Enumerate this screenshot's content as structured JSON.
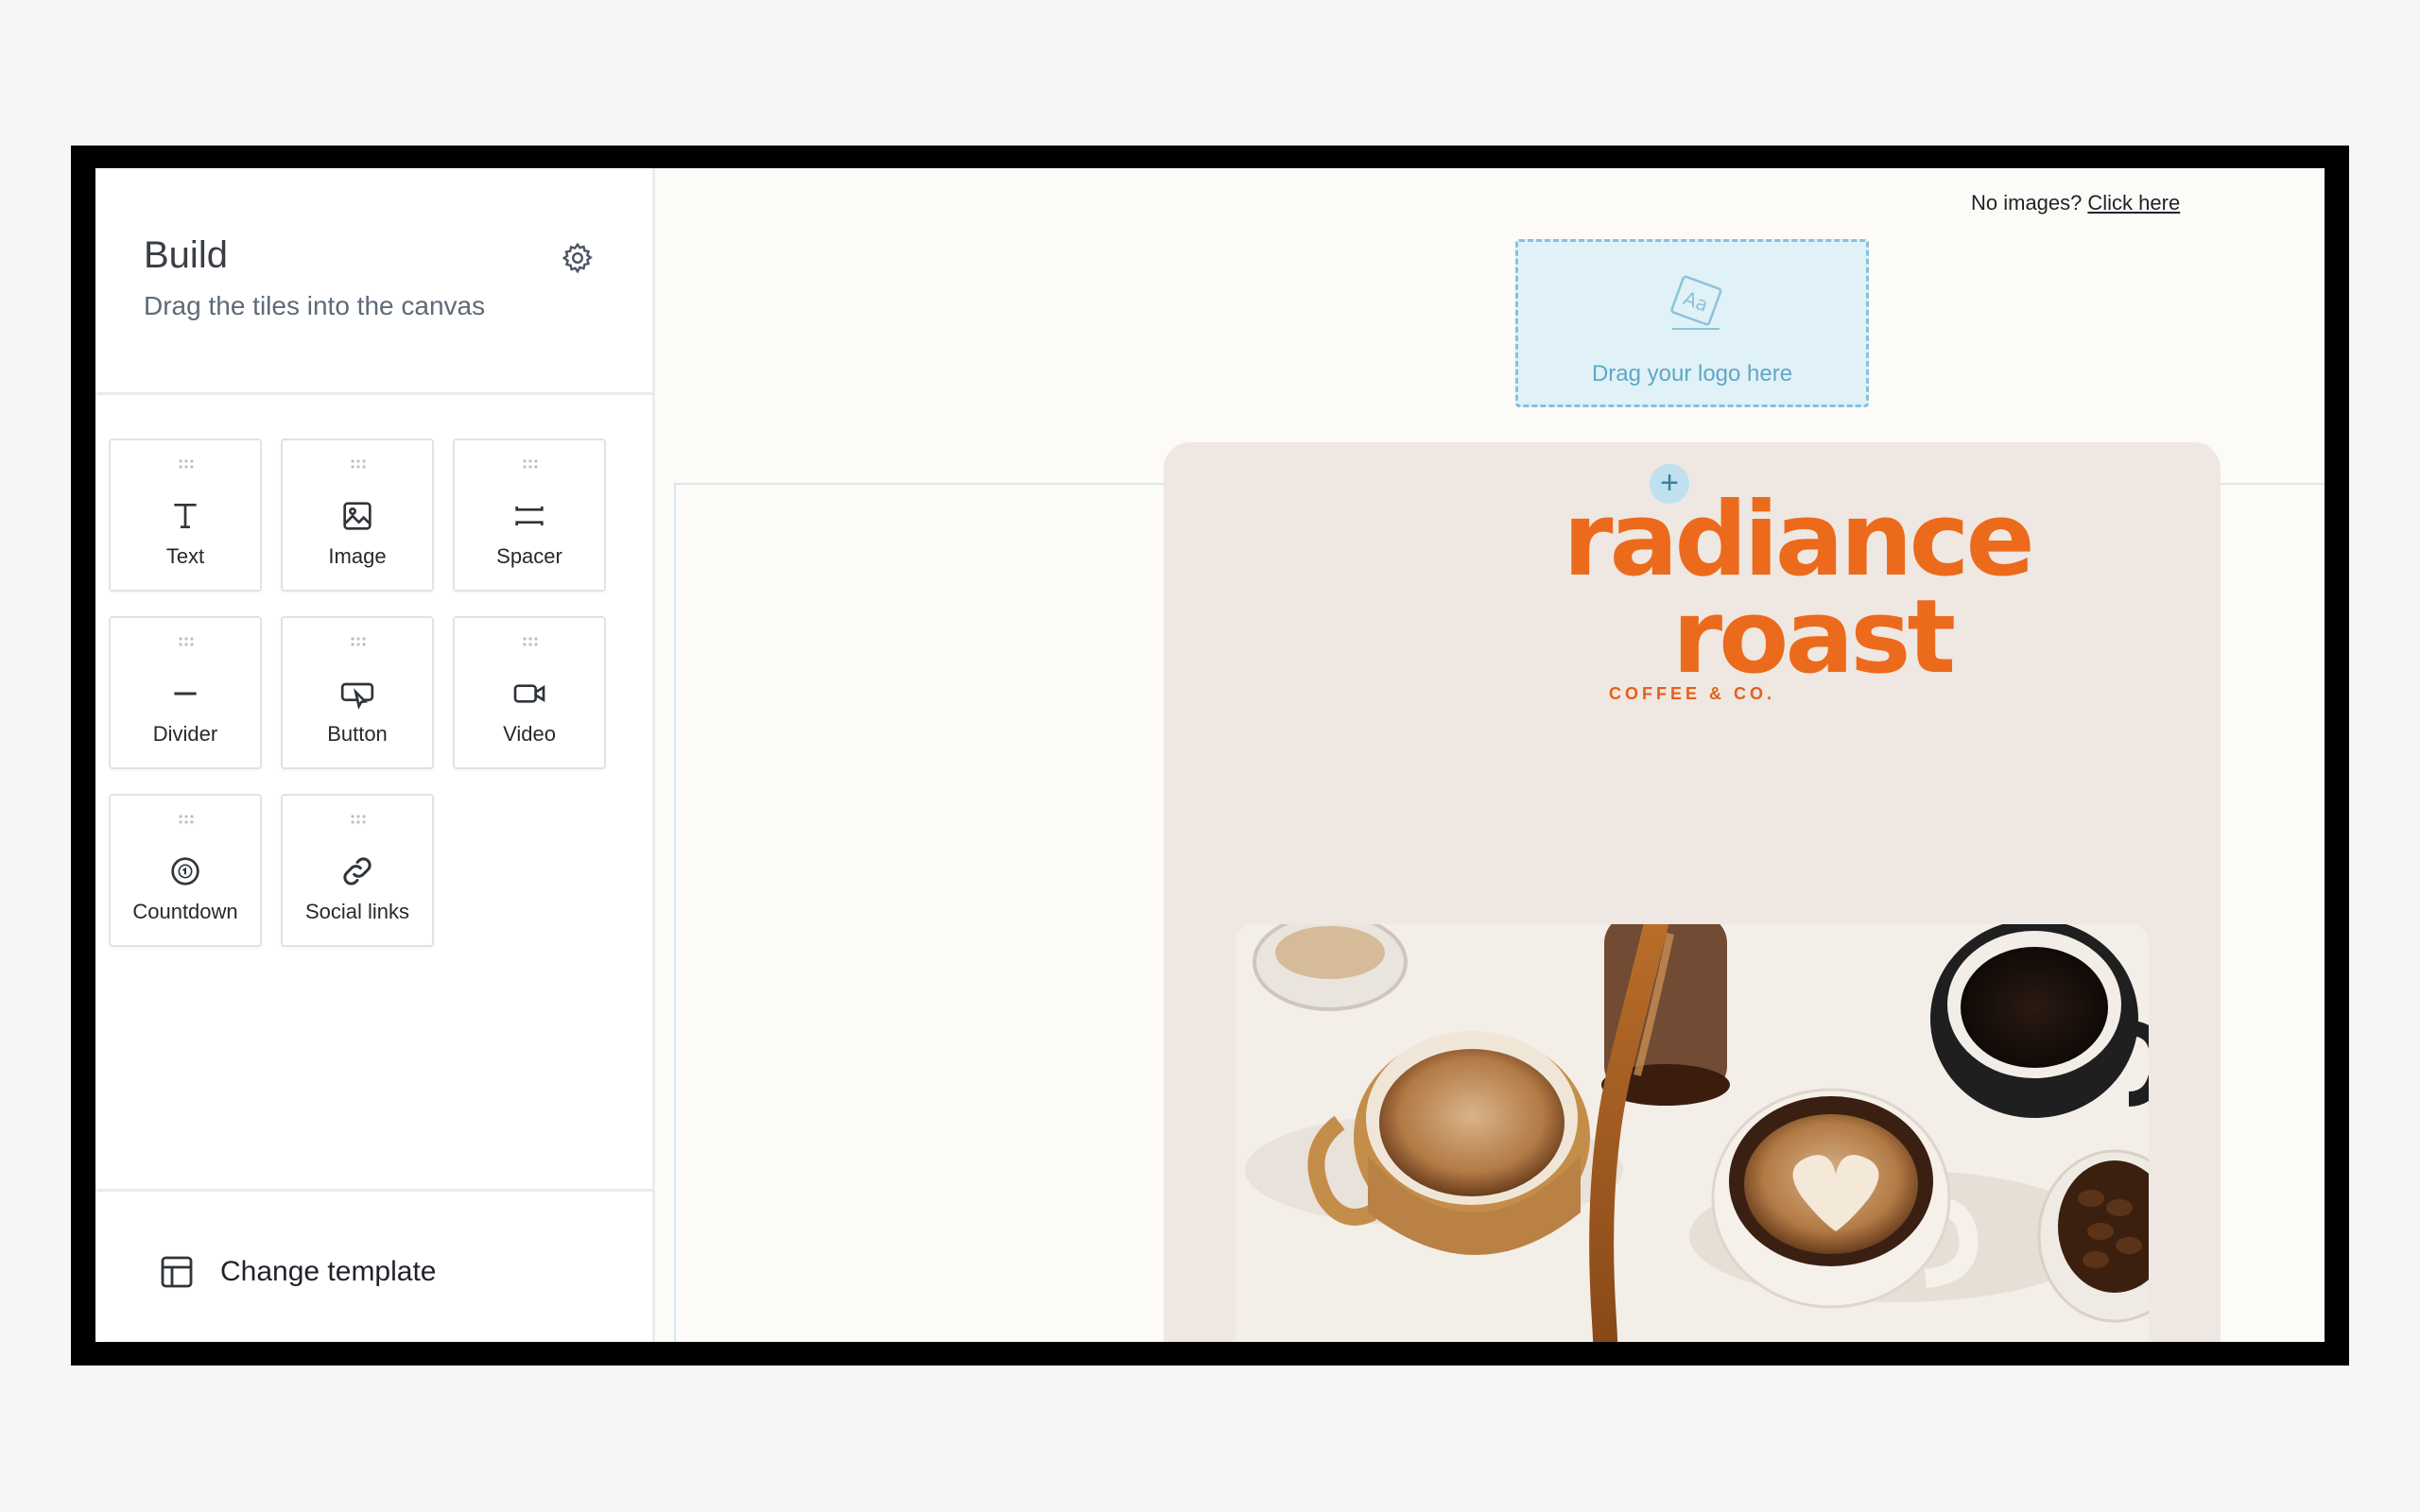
{
  "sidebar": {
    "title": "Build",
    "subtitle": "Drag the tiles into the canvas",
    "settings_icon": "gear-icon",
    "tiles": [
      {
        "label": "Text",
        "icon": "text-icon"
      },
      {
        "label": "Image",
        "icon": "image-icon"
      },
      {
        "label": "Spacer",
        "icon": "spacer-icon"
      },
      {
        "label": "Divider",
        "icon": "divider-icon"
      },
      {
        "label": "Button",
        "icon": "button-icon"
      },
      {
        "label": "Video",
        "icon": "video-icon"
      },
      {
        "label": "Countdown",
        "icon": "countdown-icon"
      },
      {
        "label": "Social links",
        "icon": "link-icon"
      }
    ],
    "footer": {
      "label": "Change template",
      "icon": "template-icon"
    }
  },
  "canvas": {
    "no_images_text": "No images?",
    "click_here": "Click here",
    "logo_drop_label": "Drag your logo here",
    "add_icon": "plus-icon",
    "brand_line1": "radiance",
    "brand_line2": "roast",
    "tagline": "COFFEE & CO."
  },
  "colors": {
    "brand_orange": "#ec6a1c",
    "drop_zone_bg": "#e1f1f8",
    "drop_zone_border": "#86c2db",
    "card_bg": "#efe7e2"
  }
}
